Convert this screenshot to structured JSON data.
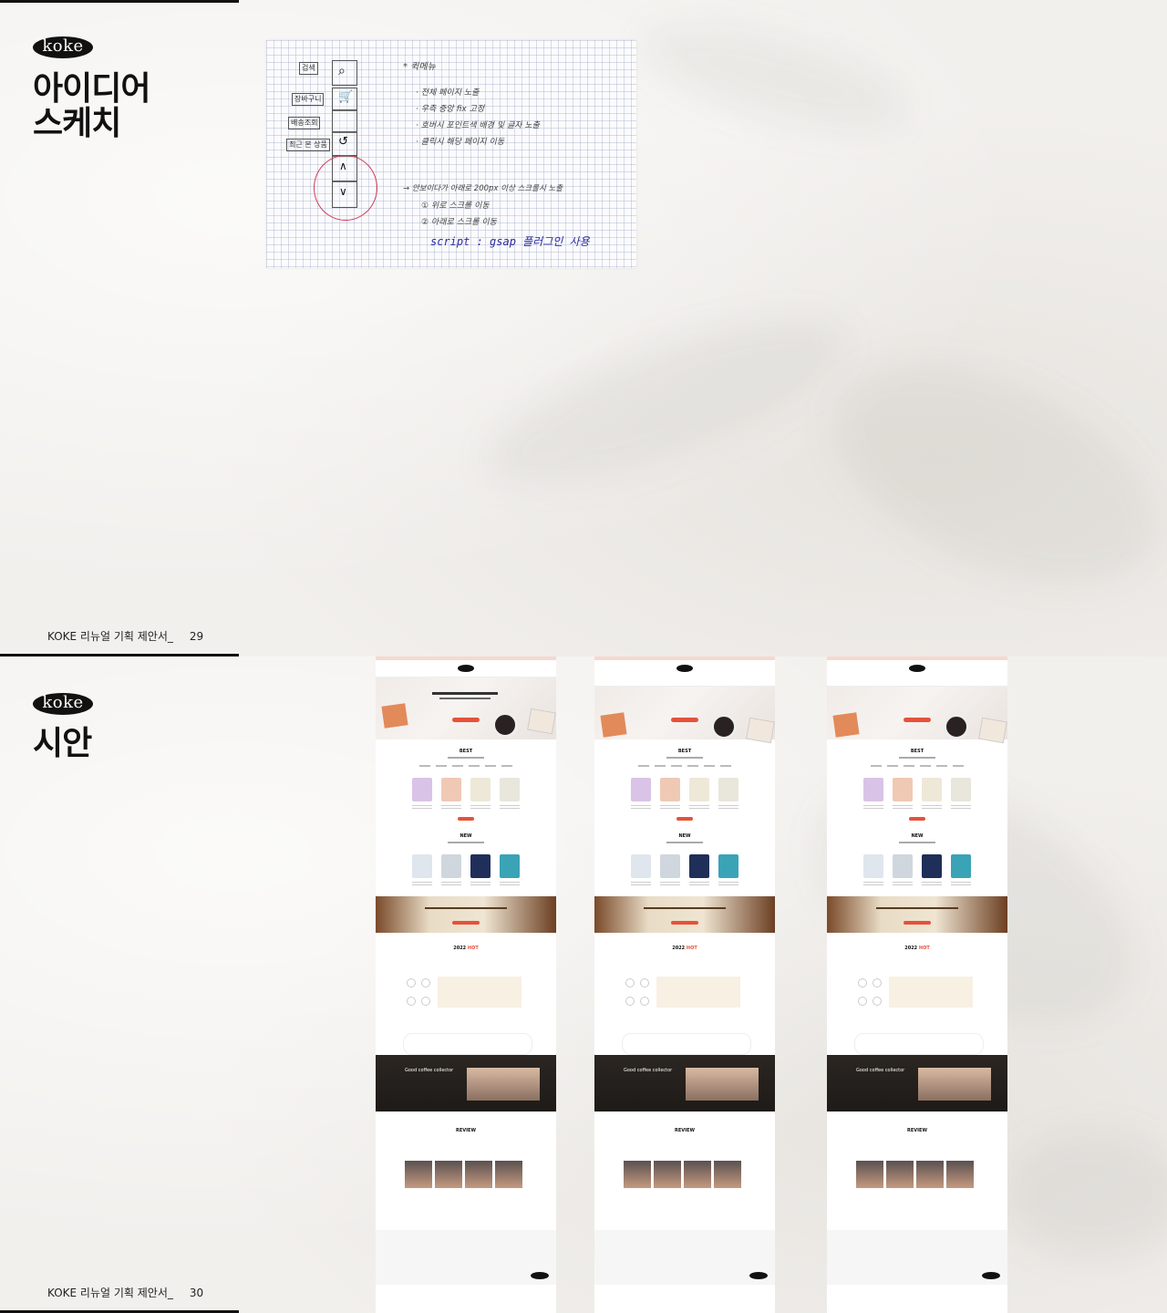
{
  "page1": {
    "logo": "koke",
    "title_line1": "아이디어",
    "title_line2": "스케치",
    "footer_text": "KOKE 리뉴얼 기획 제안서_",
    "page_number": "29",
    "sketch": {
      "labels": [
        "검색",
        "장바구니",
        "배송조회",
        "최근 본 상품"
      ],
      "heading": "* 퀵메뉴",
      "notes": [
        "· 전체 페이지 노출",
        "· 우측 중앙 fix 고정",
        "· 호버시 포인트색 배경 및 글자 노출",
        "· 클릭시 해당 페이지 이동"
      ],
      "note2": "→ 안보이다가 아래로 200px 이상 스크롤시 노출",
      "note3": "① 위로 스크롤 이동",
      "note4": "② 아래로 스크롤 이동",
      "script_note": "script : gsap 플러그인 사용"
    }
  },
  "page2": {
    "logo": "koke",
    "title": "시안",
    "footer_text": "KOKE 리뉴얼 기획 제안서_",
    "page_number": "30",
    "mockup": {
      "best": "BEST",
      "new": "NEW",
      "hot_year": "2022",
      "hot": "HOT",
      "collector": "Good coffee collector",
      "review": "REVIEW",
      "logo": "koke"
    }
  },
  "colors": {
    "accent": "#e5523a",
    "dark": "#111111",
    "sketch_circle": "#d23a55",
    "sketch_ink": "#2a2aa0"
  }
}
